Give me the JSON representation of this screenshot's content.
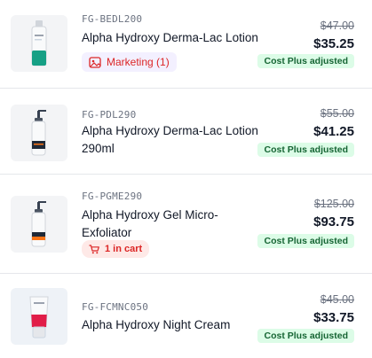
{
  "items": [
    {
      "sku": "FG-BEDL200",
      "name": "Alpha Hydroxy Derma-Lac Lotion",
      "original_price": "$47.00",
      "price": "$35.25",
      "badge": "Cost Plus adjusted",
      "tag": {
        "label": "Marketing (1)",
        "icon": "image-icon"
      },
      "image": "product-bottle-teal"
    },
    {
      "sku": "FG-PDL290",
      "name": "Alpha Hydroxy Derma-Lac Lotion 290ml",
      "original_price": "$55.00",
      "price": "$41.25",
      "badge": "Cost Plus adjusted",
      "image": "product-pump-bottle"
    },
    {
      "sku": "FG-PGME290",
      "name": "Alpha Hydroxy Gel Micro-Exfoliator",
      "original_price": "$125.00",
      "price": "$93.75",
      "badge": "Cost Plus adjusted",
      "tag": {
        "label": "1 in cart",
        "icon": "cart-icon"
      },
      "image": "product-pump-bottle-orange"
    },
    {
      "sku": "FG-FCMNC050",
      "name": "Alpha Hydroxy Night Cream",
      "original_price": "$45.00",
      "price": "$33.75",
      "badge": "Cost Plus adjusted",
      "image": "product-tube-pink"
    }
  ]
}
